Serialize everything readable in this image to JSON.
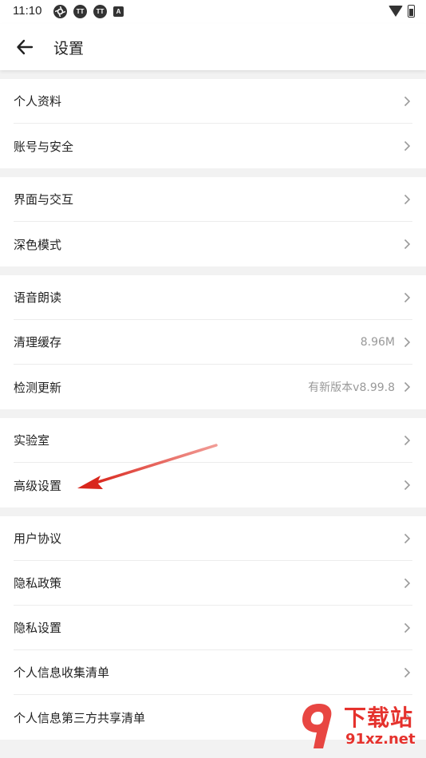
{
  "status_bar": {
    "time": "11:10",
    "icons": [
      "app-icon",
      "tt-icon",
      "tt-icon",
      "a-icon"
    ],
    "icon_labels": [
      "",
      "TT",
      "TT",
      "A"
    ],
    "right_icons": [
      "wifi-icon",
      "battery-icon"
    ]
  },
  "header": {
    "back_icon": "arrow-left-icon",
    "title": "设置"
  },
  "groups": [
    {
      "items": [
        {
          "label": "个人资料",
          "value": ""
        },
        {
          "label": "账号与安全",
          "value": ""
        }
      ]
    },
    {
      "items": [
        {
          "label": "界面与交互",
          "value": ""
        },
        {
          "label": "深色模式",
          "value": ""
        }
      ]
    },
    {
      "items": [
        {
          "label": "语音朗读",
          "value": ""
        },
        {
          "label": "清理缓存",
          "value": "8.96M"
        },
        {
          "label": "检测更新",
          "value": "有新版本v8.99.8"
        }
      ]
    },
    {
      "items": [
        {
          "label": "实验室",
          "value": ""
        },
        {
          "label": "高级设置",
          "value": ""
        }
      ]
    },
    {
      "items": [
        {
          "label": "用户协议",
          "value": ""
        },
        {
          "label": "隐私政策",
          "value": ""
        },
        {
          "label": "隐私设置",
          "value": ""
        },
        {
          "label": "个人信息收集清单",
          "value": ""
        },
        {
          "label": "个人信息第三方共享清单",
          "value": ""
        }
      ]
    }
  ],
  "annotation": {
    "type": "red-arrow",
    "points_to": "高级设置",
    "color": "#d9261c"
  },
  "watermark": {
    "line1": "下载站",
    "line2": "91xz.net",
    "color": "#e5322d"
  }
}
